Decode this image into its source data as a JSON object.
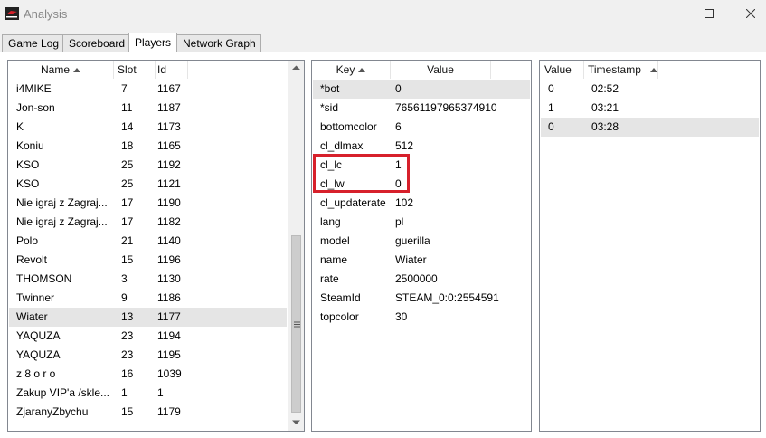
{
  "window": {
    "title": "Analysis"
  },
  "tabs": [
    {
      "label": "Game Log",
      "active": false
    },
    {
      "label": "Scoreboard",
      "active": false
    },
    {
      "label": "Players",
      "active": true
    },
    {
      "label": "Network Graph",
      "active": false
    }
  ],
  "players": {
    "headers": {
      "name": "Name",
      "slot": "Slot",
      "id": "Id"
    },
    "rows": [
      {
        "name": "i4MIKE",
        "slot": "7",
        "id": "1167"
      },
      {
        "name": "Jon-son",
        "slot": "11",
        "id": "1187"
      },
      {
        "name": "K",
        "slot": "14",
        "id": "1173"
      },
      {
        "name": "Koniu",
        "slot": "18",
        "id": "1165"
      },
      {
        "name": "KSO",
        "slot": "25",
        "id": "1192"
      },
      {
        "name": "KSO",
        "slot": "25",
        "id": "1121"
      },
      {
        "name": "Nie igraj z Zagraj...",
        "slot": "17",
        "id": "1190"
      },
      {
        "name": "Nie igraj z Zagraj...",
        "slot": "17",
        "id": "1182"
      },
      {
        "name": "Polo",
        "slot": "21",
        "id": "1140"
      },
      {
        "name": "Revolt",
        "slot": "15",
        "id": "1196"
      },
      {
        "name": "THOMSON",
        "slot": "3",
        "id": "1130"
      },
      {
        "name": "Twinner",
        "slot": "9",
        "id": "1186"
      },
      {
        "name": "Wiater",
        "slot": "13",
        "id": "1177"
      },
      {
        "name": "YAQUZA",
        "slot": "23",
        "id": "1194"
      },
      {
        "name": "YAQUZA",
        "slot": "23",
        "id": "1195"
      },
      {
        "name": "z 8 o r o",
        "slot": "16",
        "id": "1039"
      },
      {
        "name": "Zakup VIP'a /skle...",
        "slot": "1",
        "id": "1"
      },
      {
        "name": "ZjaranyZbychu",
        "slot": "15",
        "id": "1179"
      }
    ],
    "selected_index": 12
  },
  "properties": {
    "headers": {
      "key": "Key",
      "value": "Value"
    },
    "rows": [
      {
        "key": "*bot",
        "value": "0"
      },
      {
        "key": "*sid",
        "value": "76561197965374910"
      },
      {
        "key": "bottomcolor",
        "value": "6"
      },
      {
        "key": "cl_dlmax",
        "value": "512"
      },
      {
        "key": "cl_lc",
        "value": "1"
      },
      {
        "key": "cl_lw",
        "value": "0"
      },
      {
        "key": "cl_updaterate",
        "value": "102"
      },
      {
        "key": "lang",
        "value": "pl"
      },
      {
        "key": "model",
        "value": "guerilla"
      },
      {
        "key": "name",
        "value": "Wiater"
      },
      {
        "key": "rate",
        "value": "2500000"
      },
      {
        "key": "SteamId",
        "value": "STEAM_0:0:2554591"
      },
      {
        "key": "topcolor",
        "value": "30"
      }
    ],
    "selected_index": 0
  },
  "history": {
    "headers": {
      "value": "Value",
      "timestamp": "Timestamp"
    },
    "rows": [
      {
        "value": "0",
        "timestamp": "02:52"
      },
      {
        "value": "1",
        "timestamp": "03:21"
      },
      {
        "value": "0",
        "timestamp": "03:28"
      }
    ],
    "selected_index": 2
  },
  "colors": {
    "highlight_border": "#d7202b",
    "selected_row": "#e5e5e5"
  }
}
